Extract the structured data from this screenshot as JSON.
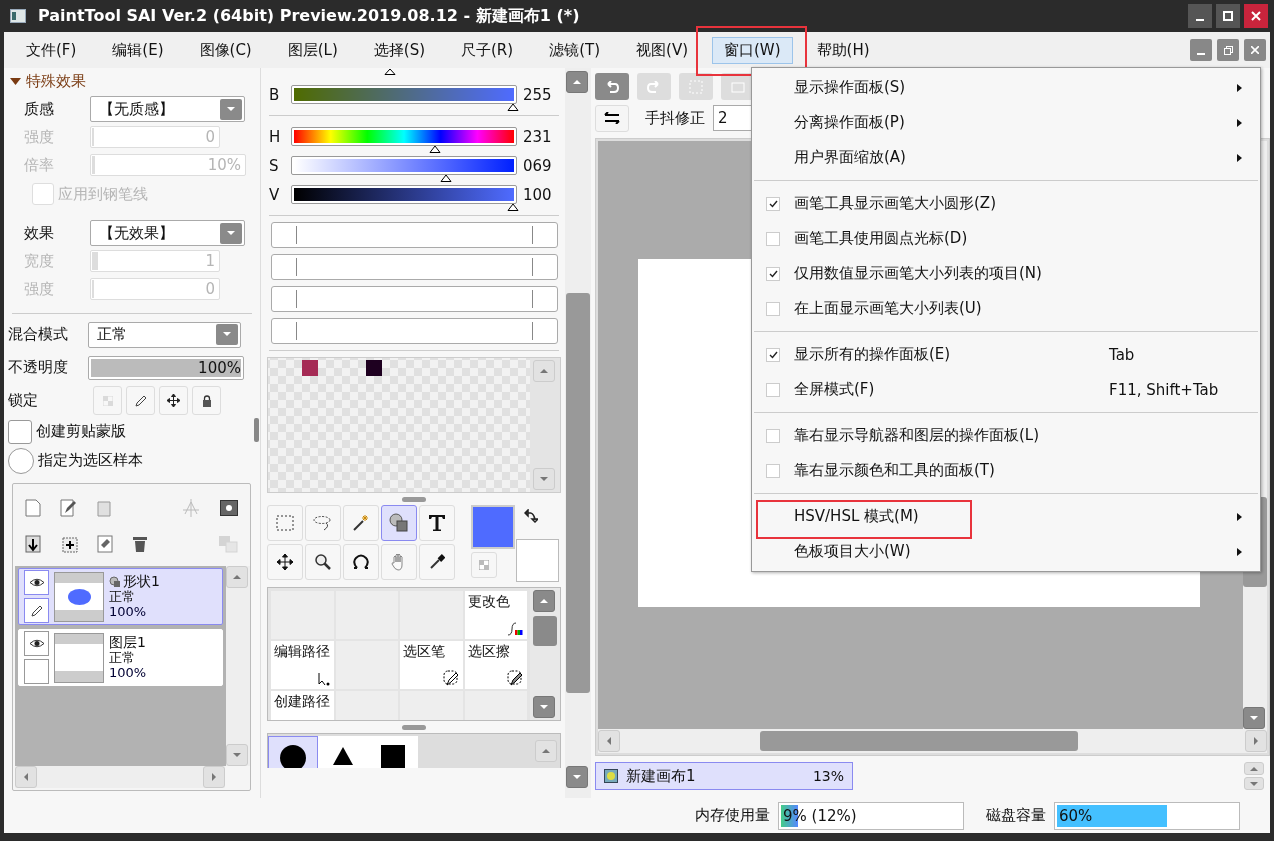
{
  "window": {
    "title": "PaintTool SAI Ver.2 (64bit) Preview.2019.08.12 - 新建画布1 (*)"
  },
  "menubar": [
    {
      "label": "文件(F)",
      "selected": false,
      "highlighted": false
    },
    {
      "label": "编辑(E)",
      "selected": false,
      "highlighted": false
    },
    {
      "label": "图像(C)",
      "selected": false,
      "highlighted": false
    },
    {
      "label": "图层(L)",
      "selected": false,
      "highlighted": false
    },
    {
      "label": "选择(S)",
      "selected": false,
      "highlighted": false
    },
    {
      "label": "尺子(R)",
      "selected": false,
      "highlighted": false
    },
    {
      "label": "滤镜(T)",
      "selected": false,
      "highlighted": false
    },
    {
      "label": "视图(V)",
      "selected": false,
      "highlighted": false
    },
    {
      "label": "窗口(W)",
      "selected": true,
      "highlighted": true
    },
    {
      "label": "帮助(H)",
      "selected": false,
      "highlighted": false
    }
  ],
  "effects": {
    "title": "特殊效果",
    "expanded": true,
    "texture": {
      "label": "质感",
      "value": "【无质感】"
    },
    "texture_strength": {
      "label": "强度",
      "value": "0",
      "level": 0,
      "disabled": true
    },
    "texture_rate": {
      "label": "倍率",
      "value": "10%",
      "level": 0.02,
      "disabled": true
    },
    "pen_line": {
      "label": "应用到钢笔线",
      "checked": false,
      "disabled": true
    },
    "effect": {
      "label": "效果",
      "value": "【无效果】"
    },
    "effect_width": {
      "label": "宽度",
      "value": "1",
      "level": 0.05,
      "disabled": true
    },
    "effect_strength": {
      "label": "强度",
      "value": "0",
      "level": 0,
      "disabled": true
    }
  },
  "layer_props": {
    "blend": {
      "label": "混合模式",
      "value": "正常"
    },
    "opacity": {
      "label": "不透明度",
      "value": "100%",
      "level": 1
    },
    "lock_label": "锁定",
    "clip": {
      "label": "创建剪贴蒙版",
      "checked": false
    },
    "sample": {
      "label": "指定为选区样本",
      "selected": false
    }
  },
  "layers": [
    {
      "name": "形状1",
      "mode": "正常",
      "opacity": "100%",
      "kind": "shape",
      "selected": true,
      "visible": true
    },
    {
      "name": "图层1",
      "mode": "正常",
      "opacity": "100%",
      "kind": "raster",
      "selected": false,
      "visible": true
    }
  ],
  "color_sliders": [
    {
      "label": "B",
      "value": "255",
      "level": 1,
      "kind": "blue"
    },
    {
      "label": "H",
      "value": "231",
      "level": 0.64,
      "kind": "hue"
    },
    {
      "label": "S",
      "value": "069",
      "level": 0.69,
      "kind": "saturation"
    },
    {
      "label": "V",
      "value": "100",
      "level": 1,
      "kind": "value"
    }
  ],
  "palette": [
    {
      "kind": "empty"
    },
    {
      "kind": "swatch",
      "color": "#a52a55"
    },
    {
      "kind": "empty"
    },
    {
      "kind": "swatch",
      "color": "#1e0020"
    }
  ],
  "tools": [
    {
      "kind": "rect-select",
      "selected": false
    },
    {
      "kind": "lasso",
      "selected": false
    },
    {
      "kind": "wand",
      "selected": false
    },
    {
      "kind": "shape",
      "selected": true
    },
    {
      "kind": "text",
      "selected": false
    },
    {
      "kind": "move",
      "selected": false
    },
    {
      "kind": "zoom",
      "selected": false
    },
    {
      "kind": "rotate",
      "selected": false
    },
    {
      "kind": "hand",
      "selected": false
    },
    {
      "kind": "picker",
      "selected": false
    }
  ],
  "brushes": [
    {
      "kind": "empty"
    },
    {
      "kind": "empty"
    },
    {
      "kind": "empty"
    },
    {
      "kind": "recolor",
      "label": "更改色"
    },
    {
      "kind": "path-edit",
      "label": "编辑路径"
    },
    {
      "kind": "empty"
    },
    {
      "kind": "sel-pen",
      "label": "选区笔"
    },
    {
      "kind": "sel-eraser",
      "label": "选区擦"
    },
    {
      "kind": "path-create",
      "label": "创建路径"
    },
    {
      "kind": "empty"
    },
    {
      "kind": "empty"
    },
    {
      "kind": "empty"
    }
  ],
  "shapes": [
    {
      "kind": "circle",
      "selected": true
    },
    {
      "kind": "triangle",
      "selected": false
    },
    {
      "kind": "square",
      "selected": false
    }
  ],
  "canvas_toolbar": {
    "stabilizer_label": "手抖修正",
    "stabilizer_value": "2"
  },
  "canvas_tab": {
    "name": "新建画布1",
    "zoom": "13%",
    "selected": true
  },
  "status": {
    "memory_label": "内存使用量",
    "memory_value": "9% (12%)",
    "memory_level": {
      "level": 0.09
    },
    "disk_label": "磁盘容量",
    "disk_value": "60%",
    "disk_level": {
      "level": 0.6
    }
  },
  "window_menu": [
    [
      {
        "label": "显示操作面板(S)",
        "kind": "submenu",
        "highlighted": false
      },
      {
        "label": "分离操作面板(P)",
        "kind": "submenu",
        "highlighted": false
      },
      {
        "label": "用户界面缩放(A)",
        "kind": "submenu",
        "highlighted": false
      }
    ],
    [
      {
        "label": "画笔工具显示画笔大小圆形(Z)",
        "kind": "check",
        "checked": true
      },
      {
        "label": "画笔工具使用圆点光标(D)",
        "kind": "check",
        "checked": false
      },
      {
        "label": "仅用数值显示画笔大小列表的项目(N)",
        "kind": "check",
        "checked": true
      },
      {
        "label": "在上面显示画笔大小列表(U)",
        "kind": "check",
        "checked": false
      }
    ],
    [
      {
        "label": "显示所有的操作面板(E)",
        "kind": "check",
        "checked": true,
        "shortcut": "Tab"
      },
      {
        "label": "全屏模式(F)",
        "kind": "check",
        "checked": false,
        "shortcut": "F11, Shift+Tab"
      }
    ],
    [
      {
        "label": "靠右显示导航器和图层的操作面板(L)",
        "kind": "check",
        "checked": false
      },
      {
        "label": "靠右显示颜色和工具的面板(T)",
        "kind": "check",
        "checked": false
      }
    ],
    [
      {
        "label": "HSV/HSL 模式(M)",
        "kind": "submenu",
        "highlighted": true
      },
      {
        "label": "色板项目大小(W)",
        "kind": "submenu",
        "highlighted": false
      }
    ]
  ]
}
